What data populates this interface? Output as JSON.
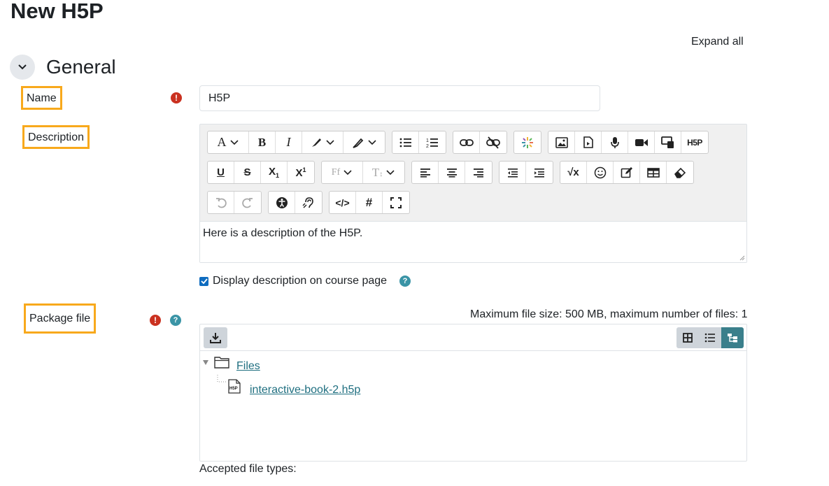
{
  "page": {
    "title": "New H5P",
    "expand_all": "Expand all"
  },
  "section": {
    "title": "General"
  },
  "fields": {
    "name": {
      "label": "Name",
      "value": "H5P"
    },
    "description": {
      "label": "Description",
      "content": "Here is a description of the H5P.",
      "display_on_course": {
        "label": "Display description on course page",
        "checked": true
      }
    },
    "package_file": {
      "label": "Package file",
      "limits": "Maximum file size: 500 MB, maximum number of files: 1",
      "folder": "Files",
      "file": "interactive-book-2.h5p",
      "accepted_types_label": "Accepted file types:"
    }
  },
  "toolbar": {
    "row1": [
      [
        "font-icon",
        "paragraph-style",
        "bold-icon",
        "italic-icon",
        "text-color-icon",
        "highlight-color-icon"
      ],
      [
        "unordered-list-icon",
        "ordered-list-icon"
      ],
      [
        "link-icon",
        "unlink-icon"
      ],
      [
        "emoji-picker-icon"
      ],
      [
        "image-icon",
        "media-icon",
        "record-audio-icon",
        "record-video-icon",
        "manage-files-icon",
        "h5p-icon"
      ]
    ],
    "row2": [
      [
        "underline-icon",
        "strikethrough-icon",
        "subscript-icon",
        "superscript-icon"
      ],
      [
        "font-family-icon",
        "font-size-icon"
      ],
      [
        "align-left-icon",
        "align-center-icon",
        "align-right-icon"
      ],
      [
        "outdent-icon",
        "indent-icon"
      ],
      [
        "equation-icon",
        "emoticon-icon",
        "edit-icon",
        "table-icon",
        "clear-formatting-icon"
      ]
    ],
    "row3": [
      [
        "undo-icon",
        "redo-icon"
      ],
      [
        "accessibility-checker-icon",
        "screenreader-helper-icon"
      ],
      [
        "html-icon",
        "special-character-icon",
        "fullscreen-icon"
      ]
    ],
    "h5p_text": "H5P"
  }
}
